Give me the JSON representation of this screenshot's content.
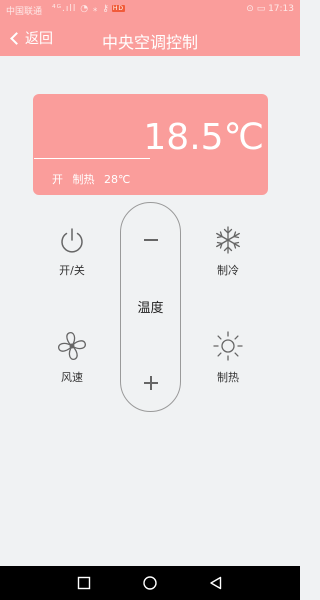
{
  "status_bar": {
    "carrier": "中国联通",
    "carrier_icons": "⁴ᴳ.ıll ◔ ⁎ ⚷",
    "hd_badge": "HD",
    "right": "⊙ ▭ 17:13"
  },
  "header": {
    "back_label": "返回",
    "title": "中央空调控制"
  },
  "display": {
    "temperature": "18.5℃",
    "power_state": "开",
    "mode": "制热",
    "set_temperature": "28℃"
  },
  "controls": {
    "power_label": "开/关",
    "fan_label": "风速",
    "cool_label": "制冷",
    "heat_label": "制热",
    "temperature_label": "温度"
  },
  "colors": {
    "accent": "#fa9d9b",
    "background": "#f0f2f3",
    "nav_bar": "#000000"
  },
  "icons": [
    "back-chevron-icon",
    "power-icon",
    "fan-icon",
    "snowflake-icon",
    "sun-icon",
    "minus-icon",
    "plus-icon",
    "square-icon",
    "circle-icon",
    "triangle-icon"
  ]
}
